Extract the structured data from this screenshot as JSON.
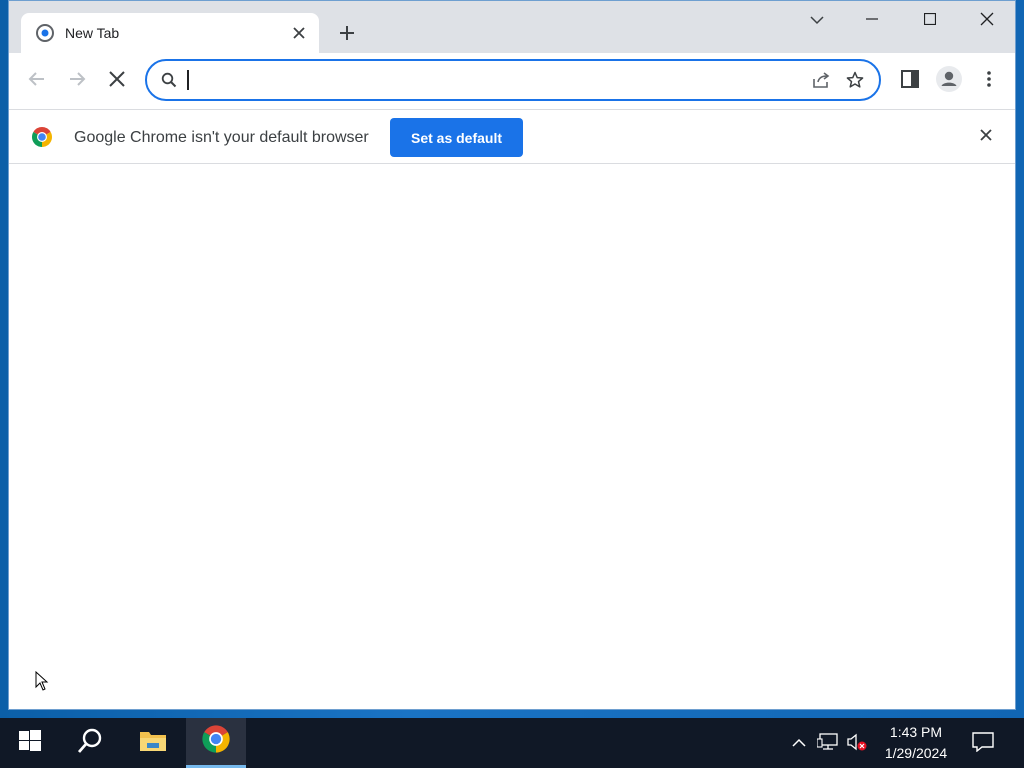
{
  "browser": {
    "tab": {
      "title": "New Tab"
    },
    "omnibox": {
      "value": "",
      "placeholder": ""
    },
    "infobar": {
      "message": "Google Chrome isn't your default browser",
      "button_label": "Set as default"
    }
  },
  "taskbar": {
    "time": "1:43 PM",
    "date": "1/29/2024"
  },
  "colors": {
    "accent": "#1a73e8",
    "taskbar": "#101826",
    "tabstrip": "#dee1e6"
  },
  "icons": [
    "chrome-favicon-icon",
    "close-icon",
    "plus-icon",
    "chevron-down-icon",
    "minimize-icon",
    "maximize-icon",
    "back-arrow-icon",
    "forward-arrow-icon",
    "stop-icon",
    "search-icon",
    "share-icon",
    "star-icon",
    "side-panel-icon",
    "profile-icon",
    "more-vert-icon",
    "chrome-logo-icon",
    "windows-start-icon",
    "file-explorer-icon",
    "chrome-app-icon",
    "chevron-up-icon",
    "network-icon",
    "volume-muted-icon",
    "notification-icon"
  ]
}
